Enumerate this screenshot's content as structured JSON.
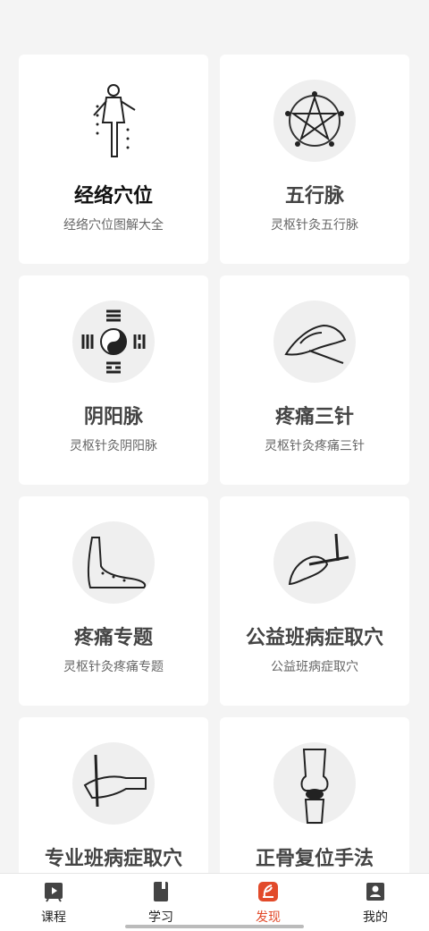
{
  "cards": [
    {
      "title": "经络穴位",
      "subtitle": "经络穴位图解大全"
    },
    {
      "title": "五行脉",
      "subtitle": "灵枢针灸五行脉"
    },
    {
      "title": "阴阳脉",
      "subtitle": "灵枢针灸阴阳脉"
    },
    {
      "title": "疼痛三针",
      "subtitle": "灵枢针灸疼痛三针"
    },
    {
      "title": "疼痛专题",
      "subtitle": "灵枢针灸疼痛专题"
    },
    {
      "title": "公益班病症取穴",
      "subtitle": "公益班病症取穴"
    },
    {
      "title": "专业班病症取穴",
      "subtitle": ""
    },
    {
      "title": "正骨复位手法",
      "subtitle": ""
    }
  ],
  "tabs": [
    {
      "label": "课程",
      "icon": "video-icon"
    },
    {
      "label": "学习",
      "icon": "book-icon"
    },
    {
      "label": "发现",
      "icon": "discover-icon"
    },
    {
      "label": "我的",
      "icon": "profile-icon"
    }
  ],
  "colors": {
    "active_tab": "#e24a2a",
    "text": "#222222"
  }
}
